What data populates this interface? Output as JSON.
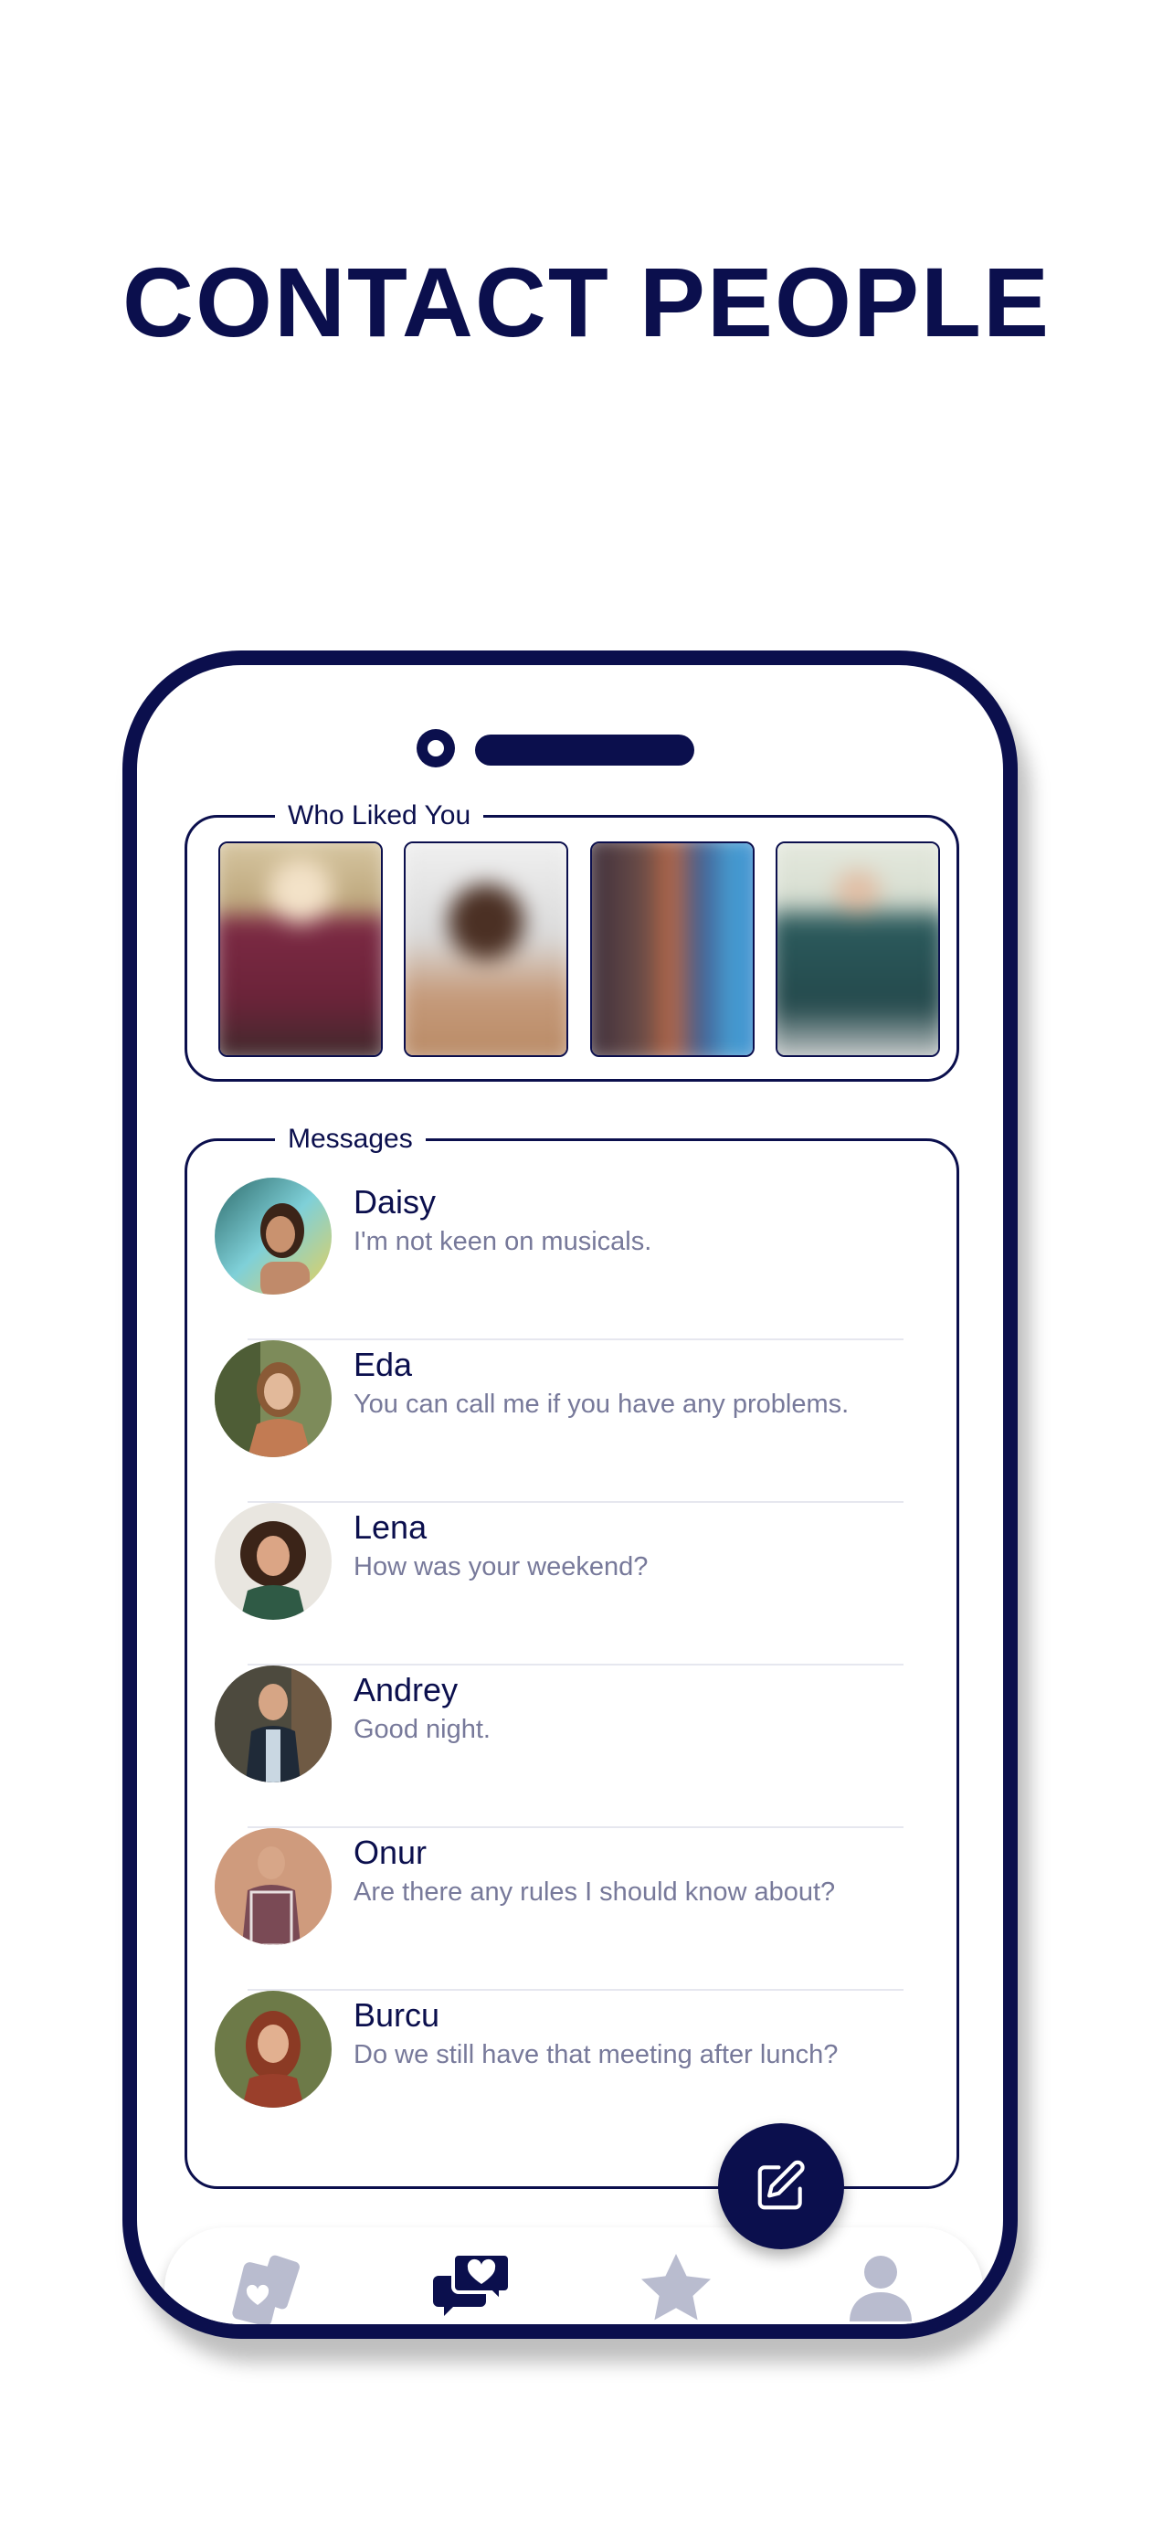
{
  "headline": "CONTACT PEOPLE",
  "colors": {
    "navy": "#0b0f4d",
    "muted": "#77799a",
    "inactive_icon": "#b9bccf"
  },
  "who_liked": {
    "title": "Who Liked You",
    "cards": [
      {
        "name": "liked-card-1"
      },
      {
        "name": "liked-card-2"
      },
      {
        "name": "liked-card-3"
      },
      {
        "name": "liked-card-4"
      }
    ]
  },
  "messages": {
    "title": "Messages",
    "items": [
      {
        "name": "Daisy",
        "text": "I'm not keen on musicals."
      },
      {
        "name": "Eda",
        "text": "You can call me if you have any problems."
      },
      {
        "name": "Lena",
        "text": "How was your weekend?"
      },
      {
        "name": "Andrey",
        "text": "Good night."
      },
      {
        "name": "Onur",
        "text": "Are there any rules I should know about?"
      },
      {
        "name": "Burcu",
        "text": "Do we still have that meeting after lunch?"
      }
    ]
  },
  "fab": {
    "icon": "edit-icon"
  },
  "tabbar": {
    "tabs": [
      {
        "icon": "cards-icon",
        "active": false
      },
      {
        "icon": "chat-heart-icon",
        "active": true
      },
      {
        "icon": "star-icon",
        "active": false
      },
      {
        "icon": "user-icon",
        "active": false
      }
    ]
  }
}
